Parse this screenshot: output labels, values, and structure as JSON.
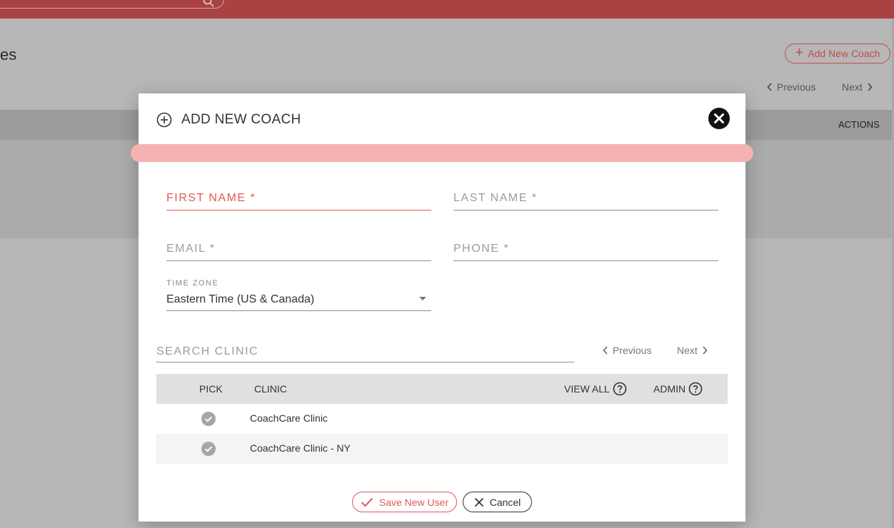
{
  "background": {
    "title_fragment": "es",
    "add_coach_button": "Add New Coach",
    "pager": {
      "previous": "Previous",
      "next": "Next"
    },
    "table": {
      "actions_header": "ACTIONS"
    }
  },
  "modal": {
    "title": "ADD NEW COACH",
    "fields": {
      "first_name": {
        "label": "FIRST NAME *",
        "value": ""
      },
      "last_name": {
        "label": "LAST NAME *",
        "value": ""
      },
      "email": {
        "label": "EMAIL *",
        "value": ""
      },
      "phone": {
        "label": "PHONE *",
        "value": ""
      }
    },
    "time_zone": {
      "label": "TIME ZONE",
      "value": "Eastern Time (US & Canada)"
    },
    "search_clinic": {
      "label": "SEARCH CLINIC",
      "value": ""
    },
    "pager": {
      "previous": "Previous",
      "next": "Next"
    },
    "table": {
      "headers": {
        "pick": "PICK",
        "clinic": "CLINIC",
        "view_all": "VIEW ALL",
        "admin": "ADMIN"
      },
      "rows": [
        {
          "clinic": "CoachCare Clinic"
        },
        {
          "clinic": "CoachCare Clinic - NY"
        }
      ]
    },
    "buttons": {
      "save": "Save New User",
      "cancel": "Cancel"
    }
  },
  "colors": {
    "topbar": "#a94242",
    "accent": "#e05a5a",
    "progress_band": "#f6b2b2",
    "overlay": "#b7b7b7",
    "check_icon": "#a6a6a6"
  }
}
